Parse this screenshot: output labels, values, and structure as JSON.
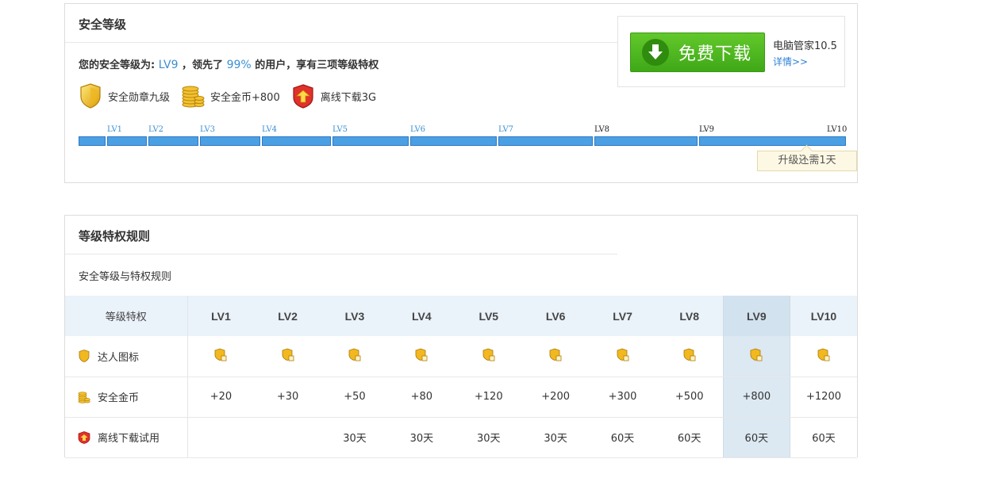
{
  "level_panel": {
    "title": "安全等级",
    "summary_prefix": "您的安全等级为:",
    "current_level": "LV9",
    "summary_mid": "，领先了",
    "percent": "99%",
    "summary_suffix": "的用户，享有三项等级特权",
    "privileges": [
      {
        "icon": "shield-badge-icon",
        "label": "安全勋章九级"
      },
      {
        "icon": "gold-coins-icon",
        "label": "安全金币+800"
      },
      {
        "icon": "offline-download-icon",
        "label": "离线下载3G"
      }
    ],
    "levels": [
      "LV1",
      "LV2",
      "LV3",
      "LV4",
      "LV5",
      "LV6",
      "LV7",
      "LV8",
      "LV9",
      "LV10"
    ],
    "upgrade_tip": "升级还需1天",
    "colors": {
      "accent_blue": "#3b8fd3",
      "bar_blue": "#4b9fe3",
      "download_green": "#4cb51f"
    }
  },
  "ad": {
    "button_label": "免费下载",
    "product_name": "电脑管家10.5",
    "details_link": "详情>>"
  },
  "rules_panel": {
    "title": "等级特权规则",
    "subtitle": "安全等级与特权规则",
    "table": {
      "corner_header": "等级特权",
      "columns": [
        "LV1",
        "LV2",
        "LV3",
        "LV4",
        "LV5",
        "LV6",
        "LV7",
        "LV8",
        "LV9",
        "LV10"
      ],
      "highlight_column": "LV9",
      "rows": [
        {
          "icon": "shield-icon",
          "label": "达人图标",
          "cells": [
            "",
            "",
            "",
            "",
            "",
            "",
            "",
            "",
            "",
            ""
          ]
        },
        {
          "icon": "coins-icon",
          "label": "安全金币",
          "cells": [
            "+20",
            "+30",
            "+50",
            "+80",
            "+120",
            "+200",
            "+300",
            "+500",
            "+800",
            "+1200"
          ]
        },
        {
          "icon": "download-gift-icon",
          "label": "离线下载试用",
          "cells": [
            "",
            "",
            "30天",
            "30天",
            "30天",
            "30天",
            "60天",
            "60天",
            "60天",
            "60天"
          ]
        }
      ]
    }
  }
}
